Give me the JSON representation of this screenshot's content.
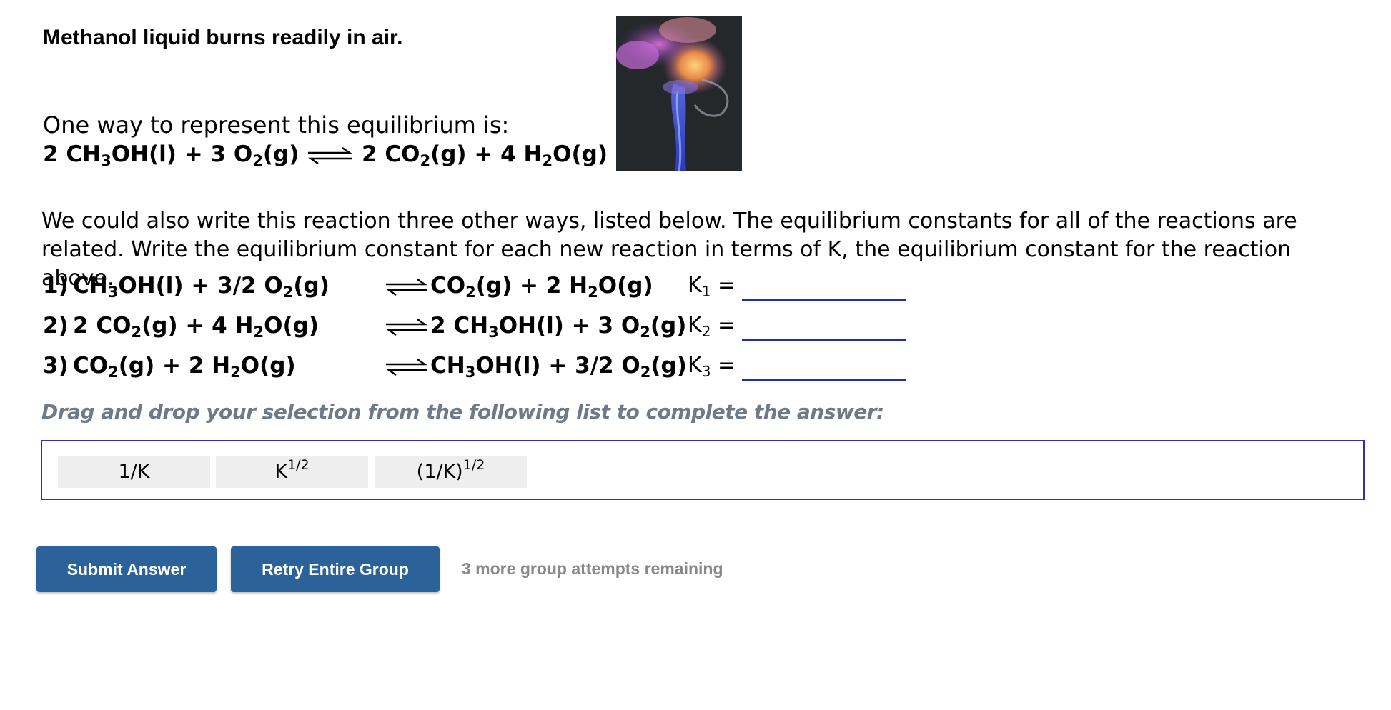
{
  "intro": "Methanol liquid burns readily in air.",
  "lead": "One way to represent this equilibrium is:",
  "main_reaction": {
    "left": [
      {
        "t": "2 CH"
      },
      {
        "s": "3"
      },
      {
        "t": "OH(l) + 3 O"
      },
      {
        "s": "2"
      },
      {
        "t": "(g)"
      }
    ],
    "right": [
      {
        "t": "2 CO"
      },
      {
        "s": "2"
      },
      {
        "t": "(g) + 4 H"
      },
      {
        "s": "2"
      },
      {
        "t": "O(g)"
      }
    ]
  },
  "image_icon": "methanol-flame-photo",
  "paragraph": "We could also write this reaction three other ways, listed below. The equilibrium constants for all of the reactions are related. Write the equilibrium constant for each new reaction in terms of K, the equilibrium constant for the reaction above.",
  "reactions": [
    {
      "num": "1)",
      "left": [
        {
          "t": "CH"
        },
        {
          "s": "3"
        },
        {
          "t": "OH(l) + 3/2 O"
        },
        {
          "s": "2"
        },
        {
          "t": "(g)"
        }
      ],
      "right": [
        {
          "t": "CO"
        },
        {
          "s": "2"
        },
        {
          "t": "(g) + 2 H"
        },
        {
          "s": "2"
        },
        {
          "t": "O(g)"
        }
      ],
      "k_letter": "K",
      "k_sub": "1",
      "equals": "=",
      "answer": ""
    },
    {
      "num": "2)",
      "left": [
        {
          "t": "2 CO"
        },
        {
          "s": "2"
        },
        {
          "t": "(g) + 4 H"
        },
        {
          "s": "2"
        },
        {
          "t": "O(g)"
        }
      ],
      "right": [
        {
          "t": "2 CH"
        },
        {
          "s": "3"
        },
        {
          "t": "OH(l) + 3 O"
        },
        {
          "s": "2"
        },
        {
          "t": "(g)"
        }
      ],
      "k_letter": "K",
      "k_sub": "2",
      "equals": "=",
      "answer": ""
    },
    {
      "num": "3)",
      "left": [
        {
          "t": "CO"
        },
        {
          "s": "2"
        },
        {
          "t": "(g) + 2 H"
        },
        {
          "s": "2"
        },
        {
          "t": "O(g)"
        }
      ],
      "right": [
        {
          "t": "CH"
        },
        {
          "s": "3"
        },
        {
          "t": "OH(l) + 3/2 O"
        },
        {
          "s": "2"
        },
        {
          "t": "(g)"
        }
      ],
      "k_letter": "K",
      "k_sub": "3",
      "equals": "=",
      "answer": ""
    }
  ],
  "instruction": "Drag and drop your selection from the following list to complete the answer:",
  "tiles": [
    {
      "base": "1/K",
      "sup": ""
    },
    {
      "base": "K",
      "sup": "1/2"
    },
    {
      "base": "(1/K)",
      "sup": "1/2"
    }
  ],
  "buttons": {
    "submit": "Submit Answer",
    "retry": "Retry Entire Group"
  },
  "attempts_text": "3 more group attempts remaining",
  "colors": {
    "accent_blue": "#1a2fb5",
    "button_blue": "#2b6299",
    "instruction_gray": "#6e7a88",
    "tile_bg": "#eeeeee"
  }
}
